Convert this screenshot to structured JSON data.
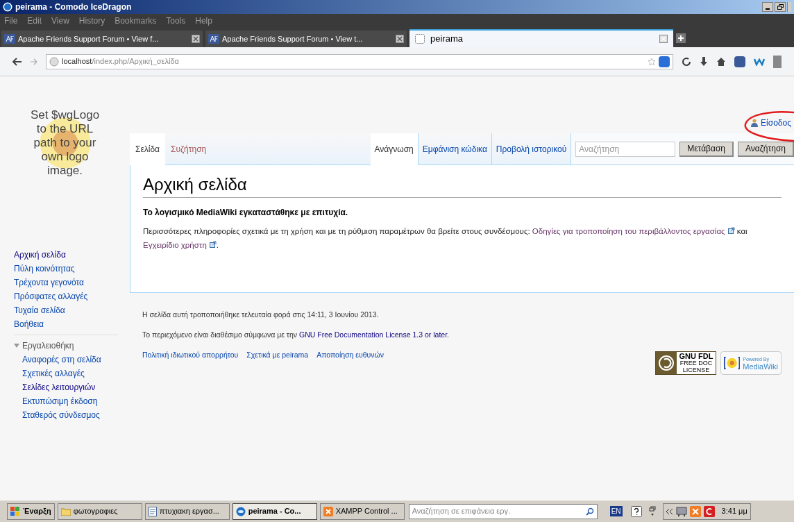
{
  "window": {
    "title": "peirama - Comodo IceDragon"
  },
  "menu": [
    "File",
    "Edit",
    "View",
    "History",
    "Bookmarks",
    "Tools",
    "Help"
  ],
  "browser_tabs": [
    {
      "label": "Apache Friends Support Forum • View f...",
      "selected": false
    },
    {
      "label": "Apache Friends Support Forum • View t...",
      "selected": false
    },
    {
      "label": "peirama",
      "selected": true
    }
  ],
  "url": {
    "host": "localhost",
    "path": "/index.php/Αρχική_σελίδα"
  },
  "user_link": "Είσοδος",
  "logo_text": "Set $wgLogo to the URL path to your own logo image.",
  "sidebar": {
    "items": [
      "Αρχική σελίδα",
      "Πύλη κοινότητας",
      "Τρέχοντα γεγονότα",
      "Πρόσφατες αλλαγές",
      "Τυχαία σελίδα",
      "Βοήθεια"
    ],
    "toolbox": {
      "title": "Εργαλειοθήκη",
      "expanded": true,
      "items": [
        {
          "label": "Αναφορές στη σελίδα",
          "visited": false
        },
        {
          "label": "Σχετικές αλλαγές",
          "visited": false
        },
        {
          "label": "Σελίδες λειτουργιών",
          "visited": true
        },
        {
          "label": "Εκτυπώσιμη έκδοση",
          "visited": false
        },
        {
          "label": "Σταθερός σύνδεσμος",
          "visited": false
        }
      ]
    }
  },
  "namespace_tabs": [
    {
      "label": "Σελίδα",
      "selected": true,
      "missing": false
    },
    {
      "label": "Συζήτηση",
      "selected": false,
      "missing": true
    }
  ],
  "view_tabs": [
    {
      "label": "Ανάγνωση",
      "selected": true
    },
    {
      "label": "Εμφάνιση κώδικα",
      "selected": false
    },
    {
      "label": "Προβολή ιστορικού",
      "selected": false
    }
  ],
  "search": {
    "placeholder": "Αναζήτηση",
    "buttons": [
      "Μετάβαση",
      "Αναζήτηση"
    ]
  },
  "heading": "Αρχική σελίδα",
  "intro": "Το λογισμικό MediaWiki εγκαταστάθηκε με επιτυχία.",
  "paragraph": [
    {
      "kind": "text",
      "text": "Περισσότερες πληροφορίες σχετικά με τη χρήση και με τη ρύθμιση παραμέτρων θα βρείτε στους συνδέσμους: "
    },
    {
      "kind": "external",
      "text": "Οδηγίες για τροποποίηση του περιβάλλοντος εργασίας"
    },
    {
      "kind": "text",
      "text": " και "
    },
    {
      "kind": "external",
      "text": "Εγχειρίδιο χρήστη"
    },
    {
      "kind": "text",
      "text": "."
    }
  ],
  "footer": {
    "modified": "Η σελίδα αυτή τροποποιήθηκε τελευταία φορά στις 14:11, 3 Ιουνίου 2013.",
    "license": [
      {
        "kind": "text",
        "text": "Το περιεχόμενο είναι διαθέσιμο σύμφωνα με την "
      },
      {
        "kind": "link",
        "text": "GNU Free Documentation License 1.3 or later"
      },
      {
        "kind": "text",
        "text": "."
      }
    ],
    "links": [
      "Πολιτική ιδιωτικού απορρήτου",
      "Σχετικά με peirama",
      "Αποποίηση ευθυνών"
    ],
    "gfdl_badge": [
      "GNU FDL",
      "FREE DOC",
      "LICENSE"
    ],
    "mediawiki_badge": [
      "Powered By",
      "MediaWiki"
    ]
  },
  "taskbar": {
    "start": "Έναρξη",
    "items": [
      {
        "label": "φωτογραφιες",
        "kind": "folder",
        "selected": false
      },
      {
        "label": "πτυχιακη εργασ...",
        "kind": "document",
        "selected": false
      },
      {
        "label": "peirama - Co...",
        "kind": "browser",
        "selected": true
      },
      {
        "label": "XAMPP Control ...",
        "kind": "xampp",
        "selected": false
      }
    ],
    "search_placeholder": "Αναζήτηση σε επιφάνεια εργ.",
    "language": "EN",
    "clock": "3:41 μμ"
  }
}
